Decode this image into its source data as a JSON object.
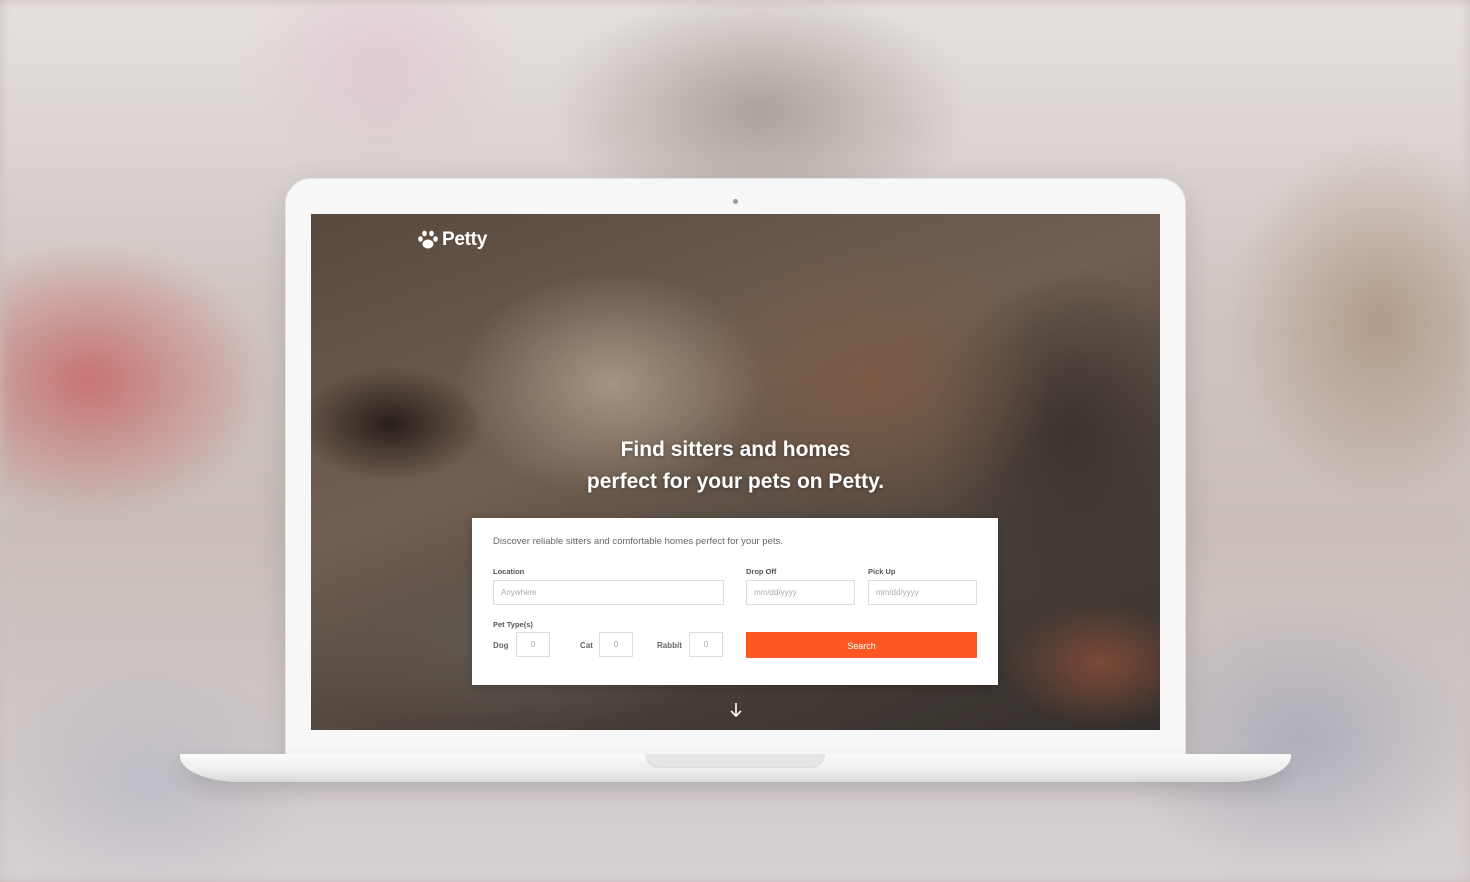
{
  "brand": {
    "name": "Petty",
    "accent": "#ff5722"
  },
  "hero": {
    "headline_line1": "Find sitters and homes",
    "headline_line2": "perfect for your pets on Petty."
  },
  "search_form": {
    "intro": "Discover reliable sitters and comfortable homes perfect for your pets.",
    "location": {
      "label": "Location",
      "placeholder": "Anywhere"
    },
    "drop_off": {
      "label": "Drop Off",
      "placeholder": "mm/dd/yyyy"
    },
    "pick_up": {
      "label": "Pick Up",
      "placeholder": "mm/dd/yyyy"
    },
    "pet_types": {
      "label": "Pet Type(s)",
      "items": [
        {
          "label": "Dog",
          "value": "0"
        },
        {
          "label": "Cat",
          "value": "0"
        },
        {
          "label": "Rabbit",
          "value": "0"
        }
      ]
    },
    "search_label": "Search"
  },
  "icons": {
    "logo": "paw-icon",
    "scroll": "arrow-down-icon"
  }
}
